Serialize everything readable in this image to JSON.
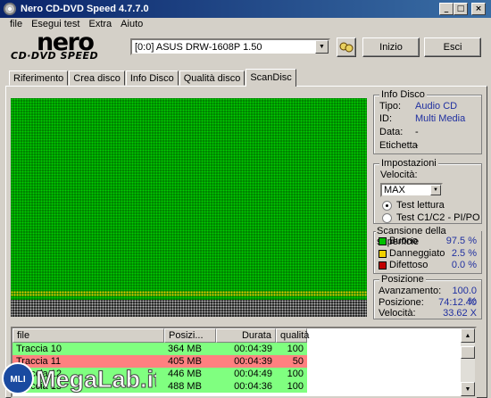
{
  "window": {
    "title": "Nero CD-DVD Speed 4.7.7.0",
    "min_icon": "_",
    "max_icon": "□",
    "close_icon": "×"
  },
  "menu": [
    "file",
    "Esegui test",
    "Extra",
    "Aiuto"
  ],
  "logo": {
    "brand": "nero",
    "product": "CD·DVD SPEED"
  },
  "drive": {
    "selected": "[0:0]   ASUS DRW-1608P 1.50"
  },
  "buttons": {
    "start": "Inizio",
    "exit": "Esci"
  },
  "tabs": [
    "Riferimento",
    "Crea disco",
    "Info Disco",
    "Qualità disco",
    "ScanDisc"
  ],
  "active_tab": "ScanDisc",
  "disc_info": {
    "title": "Info Disco",
    "rows": [
      {
        "k": "Tipo:",
        "v": "Audio CD"
      },
      {
        "k": "ID:",
        "v": "Multi Media"
      },
      {
        "k": "Data:",
        "v": "-"
      },
      {
        "k": "Etichetta",
        "v": "-"
      }
    ]
  },
  "settings": {
    "title": "Impostazioni",
    "speed_label": "Velocità:",
    "speed_value": "MAX",
    "radio1": "Test lettura",
    "radio2": "Test C1/C2 - PI/PO",
    "radio_selected": 1
  },
  "surface": {
    "title": "Scansione della superficie",
    "items": [
      {
        "label": "Buono",
        "value": "97.5 %",
        "color": "#00c000"
      },
      {
        "label": "Danneggiato",
        "value": "2.5 %",
        "color": "#f0d000"
      },
      {
        "label": "Difettoso",
        "value": "0.0 %",
        "color": "#c00000"
      }
    ]
  },
  "position": {
    "title": "Posizione",
    "items": [
      {
        "label": "Avanzamento:",
        "value": "100.0 %"
      },
      {
        "label": "Posizione:",
        "value": "74:12.40"
      },
      {
        "label": "Velocità:",
        "value": "33.62 X"
      }
    ]
  },
  "tracks": {
    "columns": [
      "file",
      "Posizi...",
      "Durata",
      "qualità"
    ],
    "rows": [
      {
        "file": "Traccia 10",
        "pos": "364 MB",
        "dur": "00:04:39",
        "q": "100",
        "color": "#80ff80"
      },
      {
        "file": "Traccia 11",
        "pos": "405 MB",
        "dur": "00:04:39",
        "q": "50",
        "color": "#ff8080"
      },
      {
        "file": "Traccia 12",
        "pos": "446 MB",
        "dur": "00:04:49",
        "q": "100",
        "color": "#80ff80"
      },
      {
        "file": "Traccia 13",
        "pos": "488 MB",
        "dur": "00:04:36",
        "q": "100",
        "color": "#80ff80"
      }
    ]
  },
  "watermark": {
    "text": "MegaLab.it",
    "badge": "MLI"
  },
  "colors": {
    "graph_bg": "#008000",
    "graph_good": "#00d000",
    "graph_damaged": "#f0d000"
  }
}
